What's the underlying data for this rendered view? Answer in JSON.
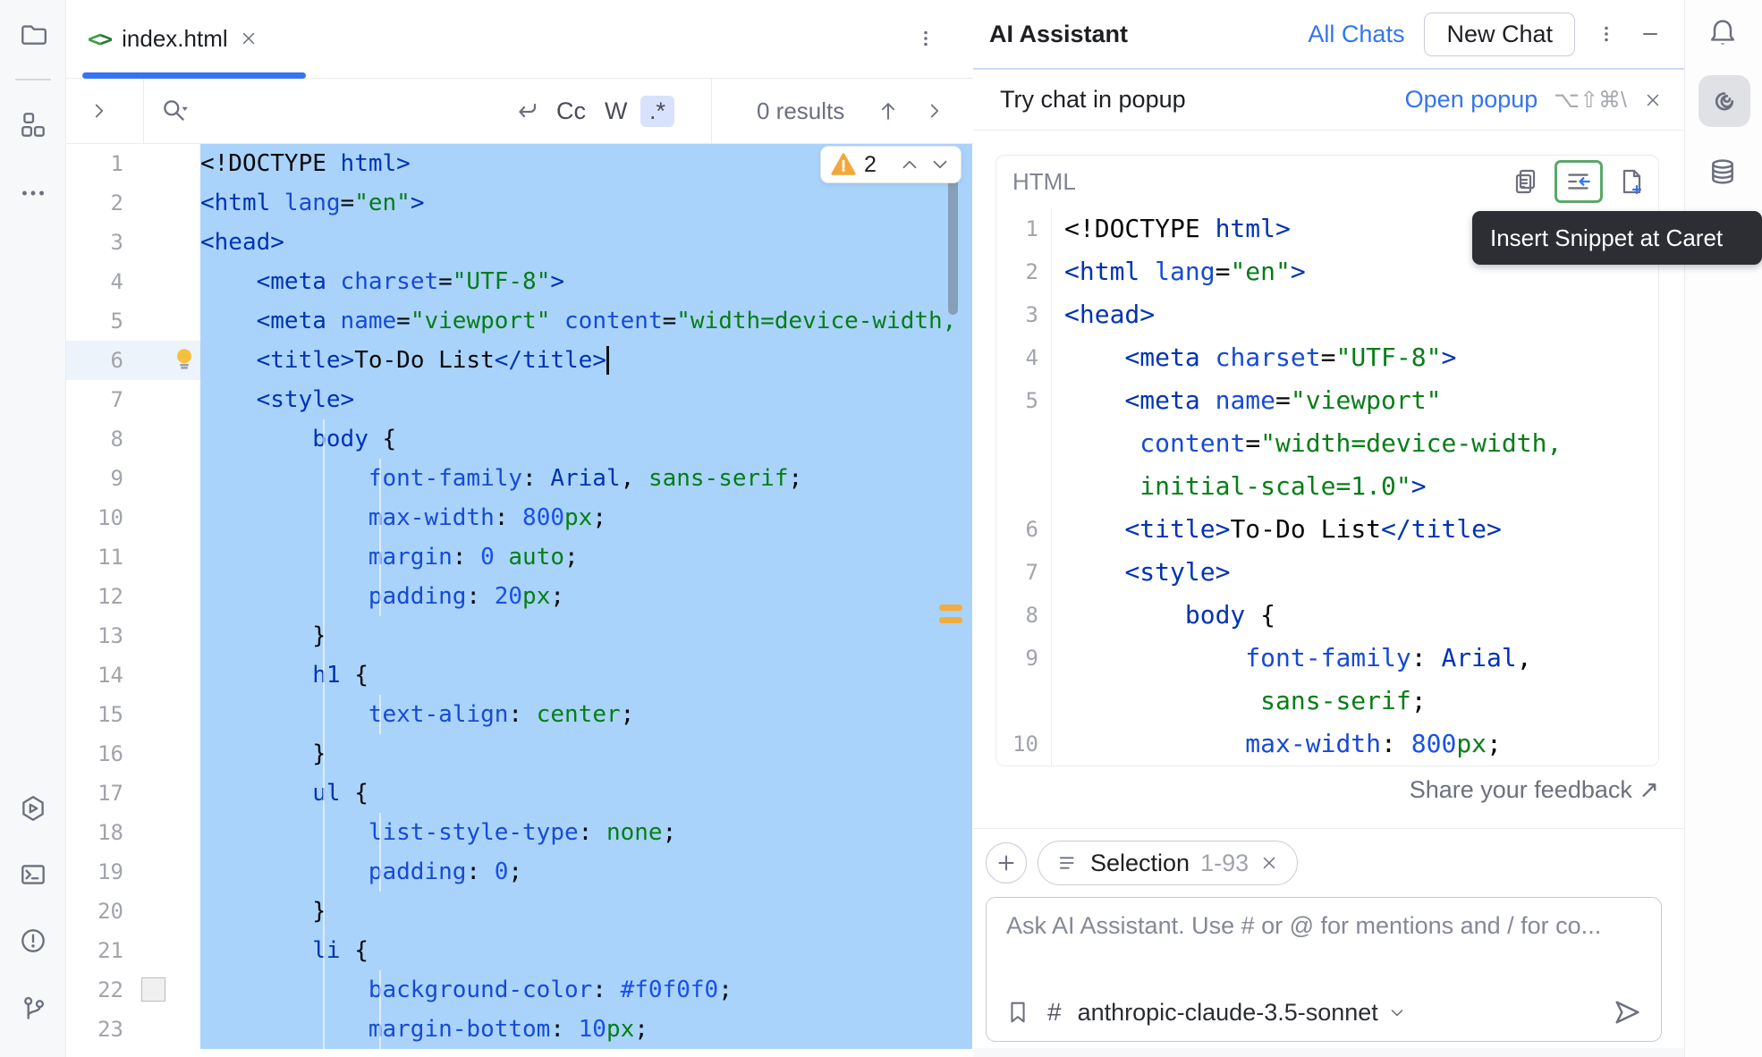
{
  "colors": {
    "accent": "#3574f0",
    "selection": "#a9d3fb",
    "warning": "#f1a73b",
    "insert_highlight": "#59a869",
    "syntax": {
      "tag": "#0033b3",
      "attribute": "#174ad4",
      "string": "#067d17",
      "number": "#1750eb",
      "plain": "#080808"
    }
  },
  "left_rail": {
    "icons": [
      "folder",
      "structure",
      "more",
      "run",
      "terminal",
      "problems",
      "version-control"
    ]
  },
  "right_rail": {
    "icons": [
      "notifications-bell",
      "ai-assistant",
      "database"
    ]
  },
  "tab_bar": {
    "active_tab": "index.html"
  },
  "search_bar": {
    "match_case": "Cc",
    "whole_words": "W",
    "regex": ".*",
    "results": "0 results"
  },
  "editor": {
    "warning_count": "2",
    "caret": {
      "line": 6,
      "col": 29
    },
    "lines": [
      {
        "n": "1",
        "sel": true,
        "tokens": [
          [
            "k",
            "<!DOCTYPE "
          ],
          [
            "t",
            "html>"
          ]
        ]
      },
      {
        "n": "2",
        "sel": true,
        "tokens": [
          [
            "t",
            "<html "
          ],
          [
            "a",
            "lang"
          ],
          [
            "k",
            "="
          ],
          [
            "s",
            "\"en\""
          ],
          [
            "t",
            ">"
          ]
        ]
      },
      {
        "n": "3",
        "sel": true,
        "tokens": [
          [
            "t",
            "<head>"
          ]
        ]
      },
      {
        "n": "4",
        "sel": true,
        "tokens": [
          [
            "k",
            "    "
          ],
          [
            "t",
            "<meta "
          ],
          [
            "a",
            "charset"
          ],
          [
            "k",
            "="
          ],
          [
            "s",
            "\"UTF-8\""
          ],
          [
            "t",
            ">"
          ]
        ]
      },
      {
        "n": "5",
        "sel": true,
        "tokens": [
          [
            "k",
            "    "
          ],
          [
            "t",
            "<meta "
          ],
          [
            "a",
            "name"
          ],
          [
            "k",
            "="
          ],
          [
            "s",
            "\"viewport\""
          ],
          [
            "k",
            " "
          ],
          [
            "a",
            "content"
          ],
          [
            "k",
            "="
          ],
          [
            "s",
            "\"width=device-width,"
          ]
        ]
      },
      {
        "n": "6",
        "sel": true,
        "cur": true,
        "icon": "lightbulb",
        "tokens": [
          [
            "k",
            "    "
          ],
          [
            "t",
            "<title>"
          ],
          [
            "k",
            "To-Do List"
          ],
          [
            "t",
            "</title>"
          ]
        ]
      },
      {
        "n": "7",
        "sel": true,
        "tokens": [
          [
            "k",
            "    "
          ],
          [
            "t",
            "<style>"
          ]
        ]
      },
      {
        "n": "8",
        "sel": true,
        "tokens": [
          [
            "k",
            "        "
          ],
          [
            "t",
            "body"
          ],
          [
            "k",
            " {"
          ]
        ]
      },
      {
        "n": "9",
        "sel": true,
        "tokens": [
          [
            "k",
            "            "
          ],
          [
            "a",
            "font-family"
          ],
          [
            "k",
            ": "
          ],
          [
            "t",
            "Arial"
          ],
          [
            "k",
            ", "
          ],
          [
            "s",
            "sans-serif"
          ],
          [
            "k",
            ";"
          ]
        ]
      },
      {
        "n": "10",
        "sel": true,
        "tokens": [
          [
            "k",
            "            "
          ],
          [
            "a",
            "max-width"
          ],
          [
            "k",
            ": "
          ],
          [
            "n",
            "800"
          ],
          [
            "s",
            "px"
          ],
          [
            "k",
            ";"
          ]
        ]
      },
      {
        "n": "11",
        "sel": true,
        "tokens": [
          [
            "k",
            "            "
          ],
          [
            "a",
            "margin"
          ],
          [
            "k",
            ": "
          ],
          [
            "n",
            "0"
          ],
          [
            "k",
            " "
          ],
          [
            "s",
            "auto"
          ],
          [
            "k",
            ";"
          ]
        ]
      },
      {
        "n": "12",
        "sel": true,
        "tokens": [
          [
            "k",
            "            "
          ],
          [
            "a",
            "padding"
          ],
          [
            "k",
            ": "
          ],
          [
            "n",
            "20"
          ],
          [
            "s",
            "px"
          ],
          [
            "k",
            ";"
          ]
        ]
      },
      {
        "n": "13",
        "sel": true,
        "tokens": [
          [
            "k",
            "        }"
          ]
        ]
      },
      {
        "n": "14",
        "sel": true,
        "tokens": [
          [
            "k",
            "        "
          ],
          [
            "t",
            "h1"
          ],
          [
            "k",
            " {"
          ]
        ]
      },
      {
        "n": "15",
        "sel": true,
        "tokens": [
          [
            "k",
            "            "
          ],
          [
            "a",
            "text-align"
          ],
          [
            "k",
            ": "
          ],
          [
            "s",
            "center"
          ],
          [
            "k",
            ";"
          ]
        ]
      },
      {
        "n": "16",
        "sel": true,
        "tokens": [
          [
            "k",
            "        }"
          ]
        ]
      },
      {
        "n": "17",
        "sel": true,
        "tokens": [
          [
            "k",
            "        "
          ],
          [
            "t",
            "ul"
          ],
          [
            "k",
            " {"
          ]
        ]
      },
      {
        "n": "18",
        "sel": true,
        "tokens": [
          [
            "k",
            "            "
          ],
          [
            "a",
            "list-style-type"
          ],
          [
            "k",
            ": "
          ],
          [
            "s",
            "none"
          ],
          [
            "k",
            ";"
          ]
        ]
      },
      {
        "n": "19",
        "sel": true,
        "tokens": [
          [
            "k",
            "            "
          ],
          [
            "a",
            "padding"
          ],
          [
            "k",
            ": "
          ],
          [
            "n",
            "0"
          ],
          [
            "k",
            ";"
          ]
        ]
      },
      {
        "n": "20",
        "sel": true,
        "tokens": [
          [
            "k",
            "        }"
          ]
        ]
      },
      {
        "n": "21",
        "sel": true,
        "tokens": [
          [
            "k",
            "        "
          ],
          [
            "t",
            "li"
          ],
          [
            "k",
            " {"
          ]
        ]
      },
      {
        "n": "22",
        "sel": true,
        "icon": "color-swatch",
        "tokens": [
          [
            "k",
            "            "
          ],
          [
            "a",
            "background-color"
          ],
          [
            "k",
            ": "
          ],
          [
            "n",
            "#f0f0f0"
          ],
          [
            "k",
            ";"
          ]
        ]
      },
      {
        "n": "23",
        "sel": true,
        "tokens": [
          [
            "k",
            "            "
          ],
          [
            "a",
            "margin-bottom"
          ],
          [
            "k",
            ": "
          ],
          [
            "n",
            "10"
          ],
          [
            "s",
            "px"
          ],
          [
            "k",
            ";"
          ]
        ]
      }
    ]
  },
  "assistant": {
    "title": "AI Assistant",
    "all_chats_label": "All Chats",
    "new_chat_label": "New Chat",
    "banner": {
      "text": "Try chat in popup",
      "action": "Open popup",
      "shortcut": "⌥⇧⌘\\"
    },
    "snippet": {
      "language": "HTML",
      "icons": [
        "copy",
        "insert-snippet-at-caret",
        "create-file-from-snippet"
      ],
      "rows": [
        {
          "n": "1",
          "tokens": [
            [
              "k",
              "<!DOCTYPE "
            ],
            [
              "t",
              "html>"
            ]
          ]
        },
        {
          "n": "2",
          "tokens": [
            [
              "t",
              "<html "
            ],
            [
              "a",
              "lang"
            ],
            [
              "k",
              "="
            ],
            [
              "s",
              "\"en\""
            ],
            [
              "t",
              ">"
            ]
          ]
        },
        {
          "n": "3",
          "tokens": [
            [
              "t",
              "<head>"
            ]
          ]
        },
        {
          "n": "4",
          "tokens": [
            [
              "k",
              "    "
            ],
            [
              "t",
              "<meta "
            ],
            [
              "a",
              "charset"
            ],
            [
              "k",
              "="
            ],
            [
              "s",
              "\"UTF-8\""
            ],
            [
              "t",
              ">"
            ]
          ]
        },
        {
          "n": "5",
          "tokens": [
            [
              "k",
              "    "
            ],
            [
              "t",
              "<meta "
            ],
            [
              "a",
              "name"
            ],
            [
              "k",
              "="
            ],
            [
              "s",
              "\"viewport\""
            ]
          ]
        },
        {
          "n": "",
          "tokens": [
            [
              "k",
              "     "
            ],
            [
              "a",
              "content"
            ],
            [
              "k",
              "="
            ],
            [
              "s",
              "\"width=device-width,"
            ]
          ]
        },
        {
          "n": "",
          "tokens": [
            [
              "k",
              "     "
            ],
            [
              "s",
              "initial-scale=1.0\""
            ],
            [
              "t",
              ">"
            ]
          ]
        },
        {
          "n": "6",
          "tokens": [
            [
              "k",
              "    "
            ],
            [
              "t",
              "<title>"
            ],
            [
              "k",
              "To-Do List"
            ],
            [
              "t",
              "</title>"
            ]
          ]
        },
        {
          "n": "7",
          "tokens": [
            [
              "k",
              "    "
            ],
            [
              "t",
              "<style>"
            ]
          ]
        },
        {
          "n": "8",
          "tokens": [
            [
              "k",
              "        "
            ],
            [
              "t",
              "body"
            ],
            [
              "k",
              " {"
            ]
          ]
        },
        {
          "n": "9",
          "tokens": [
            [
              "k",
              "            "
            ],
            [
              "a",
              "font-family"
            ],
            [
              "k",
              ": "
            ],
            [
              "t",
              "Arial"
            ],
            [
              "k",
              ","
            ]
          ]
        },
        {
          "n": "",
          "tokens": [
            [
              "k",
              "             "
            ],
            [
              "s",
              "sans-serif"
            ],
            [
              "k",
              ";"
            ]
          ]
        },
        {
          "n": "10",
          "tokens": [
            [
              "k",
              "            "
            ],
            [
              "a",
              "max-width"
            ],
            [
              "k",
              ": "
            ],
            [
              "n",
              "800"
            ],
            [
              "s",
              "px"
            ],
            [
              "k",
              ";"
            ]
          ]
        }
      ]
    },
    "tooltip": "Insert Snippet at Caret",
    "feedback_label": "Share your feedback ↗",
    "selection_chip": {
      "label": "Selection",
      "range": "1-93"
    },
    "prompt": {
      "placeholder": "Ask AI Assistant. Use # or @ for mentions and / for co...",
      "hash_label": "#",
      "model": "anthropic-claude-3.5-sonnet"
    }
  }
}
